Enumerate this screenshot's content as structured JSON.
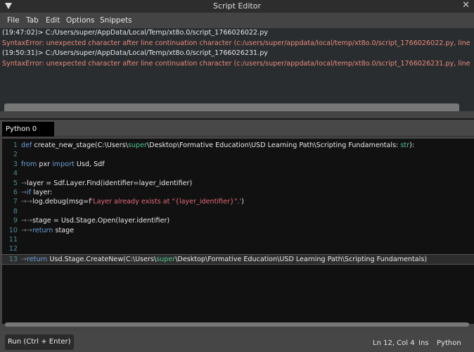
{
  "window": {
    "title": "Script Editor"
  },
  "menu": [
    "File",
    "Tab",
    "Edit",
    "Options",
    "Snippets"
  ],
  "output": [
    {
      "type": "cmd",
      "text": "(19:47:02)> C:/Users/super/AppData/Local/Temp/xt8o.0/script_1766026022.py"
    },
    {
      "type": "err",
      "text": "SyntaxError: unexpected character after line continuation character (c:/users/super/appdata/local/temp/xt8o.0/script_1766026022.py, line"
    },
    {
      "type": "cmd",
      "text": "(19:50:31)> C:/Users/super/AppData/Local/Temp/xt8o.0/script_1766026231.py"
    },
    {
      "type": "err",
      "text": "SyntaxError: unexpected character after line continuation character (c:/users/super/appdata/local/temp/xt8o.0/script_1766026231.py, line"
    }
  ],
  "tabs": [
    {
      "label": "Python 0",
      "active": true
    }
  ],
  "code": [
    {
      "n": "1",
      "tokens": [
        [
          "k",
          "def"
        ],
        [
          "n",
          " create_new_stage(C:\\Users\\"
        ],
        [
          "g",
          "super"
        ],
        [
          "n",
          "\\Desktop\\Formative Education\\USD Learning Path\\Scripting Fundamentals: "
        ],
        [
          "g",
          "str"
        ],
        [
          "n",
          "):"
        ]
      ]
    },
    {
      "n": "2",
      "tokens": []
    },
    {
      "n": "3",
      "tokens": [
        [
          "k",
          "from"
        ],
        [
          "n",
          " pxr "
        ],
        [
          "k",
          "import"
        ],
        [
          "n",
          " Usd, Sdf"
        ]
      ]
    },
    {
      "n": "4",
      "tokens": []
    },
    {
      "n": "5",
      "tokens": [
        [
          "tab-arrow",
          "→"
        ],
        [
          "n",
          "layer = Sdf.Layer.Find(identifier=layer_identifier)"
        ]
      ]
    },
    {
      "n": "6",
      "tokens": [
        [
          "tab-arrow",
          "→"
        ],
        [
          "k",
          "if"
        ],
        [
          "n",
          " layer:"
        ]
      ]
    },
    {
      "n": "7",
      "tokens": [
        [
          "tab-arrow",
          "→→"
        ],
        [
          "n",
          "log.debug(msg=f"
        ],
        [
          "s",
          "'Layer already exists at \"{layer_identifier}\".'"
        ],
        [
          "n",
          ")"
        ]
      ]
    },
    {
      "n": "8",
      "tokens": []
    },
    {
      "n": "9",
      "tokens": [
        [
          "tab-arrow",
          "→→"
        ],
        [
          "n",
          "stage = Usd.Stage.Open(layer.identifier)"
        ]
      ]
    },
    {
      "n": "10",
      "tokens": [
        [
          "tab-arrow",
          "→→"
        ],
        [
          "k",
          "return"
        ],
        [
          "n",
          " stage"
        ]
      ]
    },
    {
      "n": "11",
      "tokens": []
    },
    {
      "n": "12",
      "tokens": []
    },
    {
      "n": "13",
      "tokens": [
        [
          "tab-arrow",
          "→"
        ],
        [
          "k",
          "return"
        ],
        [
          "n",
          " Usd.Stage.CreateNew(C:\\Users\\"
        ],
        [
          "g",
          "super"
        ],
        [
          "n",
          "\\Desktop\\Formative Education\\USD Learning Path\\Scripting Fundamentals)"
        ]
      ]
    }
  ],
  "footer": {
    "run_label": "Run (Ctrl + Enter)",
    "position": "Ln 12, Col 4",
    "mode": "Ins",
    "language": "Python"
  }
}
